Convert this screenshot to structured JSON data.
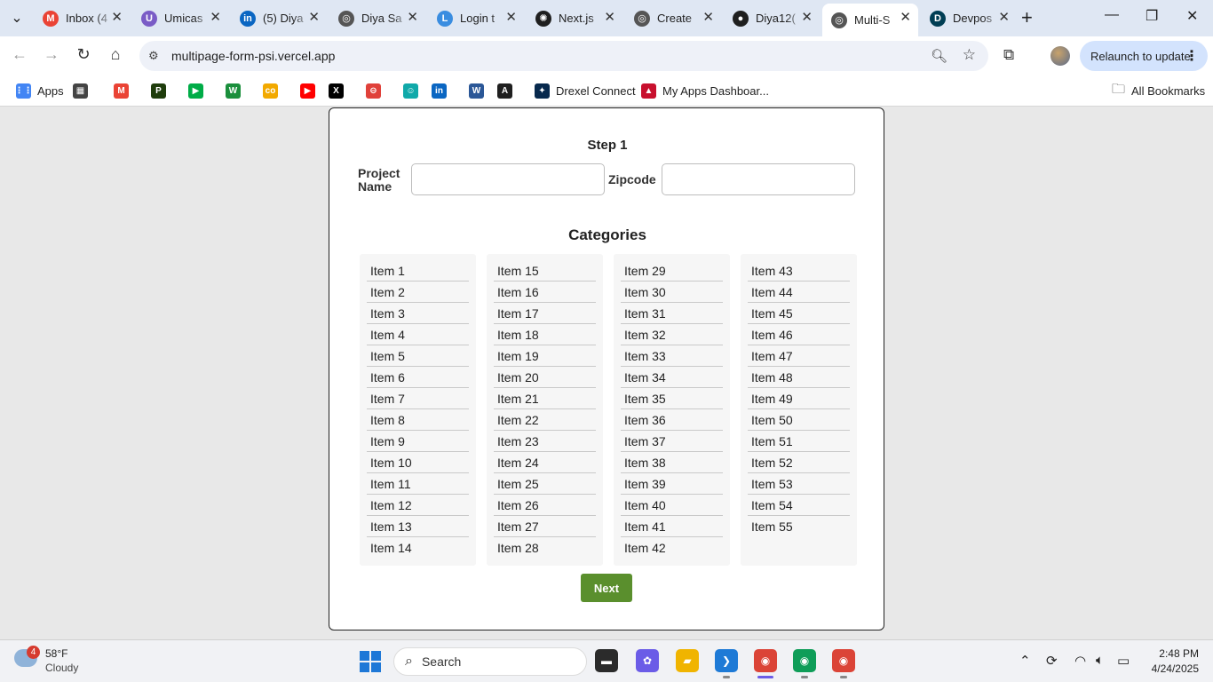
{
  "browser": {
    "tabs": [
      {
        "title": "Inbox (4",
        "favicon": "gmail-icon",
        "color": "#ea4335",
        "glyph": "M"
      },
      {
        "title": "Umicas",
        "favicon": "umicas-icon",
        "color": "#7a5cc6",
        "glyph": "U"
      },
      {
        "title": "(5) Diya",
        "favicon": "linkedin-icon",
        "color": "#0a66c2",
        "glyph": "in"
      },
      {
        "title": "Diya Sa",
        "favicon": "globe-icon",
        "color": "#555555",
        "glyph": "◎"
      },
      {
        "title": "Login t",
        "favicon": "login-icon",
        "color": "#3a8de0",
        "glyph": "L"
      },
      {
        "title": "Next.js",
        "favicon": "chatgpt-icon",
        "color": "#1f1f1f",
        "glyph": "✺"
      },
      {
        "title": "Create",
        "favicon": "globe-icon",
        "color": "#555555",
        "glyph": "◎"
      },
      {
        "title": "Diya12(",
        "favicon": "github-icon",
        "color": "#1f1f1f",
        "glyph": "●"
      },
      {
        "title": "Multi-S",
        "favicon": "globe-icon",
        "color": "#555555",
        "glyph": "◎",
        "active": true
      },
      {
        "title": "Devpos",
        "favicon": "devpost-icon",
        "color": "#003e54",
        "glyph": "D"
      }
    ],
    "url": "multipage-form-psi.vercel.app",
    "relaunch_label": "Relaunch to update",
    "bookmarks": [
      {
        "label": "Apps",
        "name": "apps-icon",
        "color": "#4285f4",
        "glyph": "⋮⋮"
      },
      {
        "label": "",
        "name": "grid-icon",
        "color": "#444444",
        "glyph": "▦"
      },
      {
        "label": "",
        "name": "gmail-icon",
        "color": "#ea4335",
        "glyph": "M"
      },
      {
        "label": "",
        "name": "paypal-icon",
        "color": "#1f3d0c",
        "glyph": "P"
      },
      {
        "label": "",
        "name": "meet-icon",
        "color": "#00ac47",
        "glyph": "▶"
      },
      {
        "label": "",
        "name": "wellfound-icon",
        "color": "#1a8f3c",
        "glyph": "W"
      },
      {
        "label": "",
        "name": "coursera-icon",
        "color": "#f2a900",
        "glyph": "co"
      },
      {
        "label": "",
        "name": "youtube-icon",
        "color": "#ff0000",
        "glyph": "▶"
      },
      {
        "label": "",
        "name": "x-icon",
        "color": "#000000",
        "glyph": "X"
      },
      {
        "label": "",
        "name": "circle-icon",
        "color": "#e0413a",
        "glyph": "⊖"
      },
      {
        "label": "",
        "name": "teal-app-icon",
        "color": "#10a9a9",
        "glyph": "☺"
      },
      {
        "label": "",
        "name": "linkedin-icon",
        "color": "#0a66c2",
        "glyph": "in"
      },
      {
        "label": "",
        "name": "word-icon",
        "color": "#2b5797",
        "glyph": "W"
      },
      {
        "label": "",
        "name": "app-icon",
        "color": "#1f1f1f",
        "glyph": "A"
      },
      {
        "label": "Drexel Connect",
        "name": "drexel-icon",
        "color": "#07294d",
        "glyph": "✦"
      },
      {
        "label": "My Apps Dashboar...",
        "name": "myapps-icon",
        "color": "#c8102e",
        "glyph": "▲"
      }
    ],
    "all_bookmarks_label": "All Bookmarks"
  },
  "form": {
    "step_title": "Step 1",
    "project_name_label": "Project Name",
    "project_name_value": "",
    "zipcode_label": "Zipcode",
    "zipcode_value": "",
    "categories_title": "Categories",
    "category_columns": [
      [
        "Item 1",
        "Item 2",
        "Item 3",
        "Item 4",
        "Item 5",
        "Item 6",
        "Item 7",
        "Item 8",
        "Item 9",
        "Item 10",
        "Item 11",
        "Item 12",
        "Item 13",
        "Item 14"
      ],
      [
        "Item 15",
        "Item 16",
        "Item 17",
        "Item 18",
        "Item 19",
        "Item 20",
        "Item 21",
        "Item 22",
        "Item 23",
        "Item 24",
        "Item 25",
        "Item 26",
        "Item 27",
        "Item 28"
      ],
      [
        "Item 29",
        "Item 30",
        "Item 31",
        "Item 32",
        "Item 33",
        "Item 34",
        "Item 35",
        "Item 36",
        "Item 37",
        "Item 38",
        "Item 39",
        "Item 40",
        "Item 41",
        "Item 42"
      ],
      [
        "Item 43",
        "Item 44",
        "Item 45",
        "Item 46",
        "Item 47",
        "Item 48",
        "Item 49",
        "Item 50",
        "Item 51",
        "Item 52",
        "Item 53",
        "Item 54",
        "Item 55"
      ]
    ],
    "next_label": "Next",
    "accent_color": "#5a8f2d"
  },
  "taskbar": {
    "weather_badge": "4",
    "weather_temp": "58°F",
    "weather_condition": "Cloudy",
    "search_label": "Search",
    "time": "2:48 PM",
    "date": "4/24/2025",
    "apps": [
      {
        "name": "terminal-app-icon",
        "color": "#2b2b2b",
        "glyph": "▬"
      },
      {
        "name": "copilot-app-icon",
        "color": "#6b5ce7",
        "glyph": "✿"
      },
      {
        "name": "file-explorer-icon",
        "color": "#f0b400",
        "glyph": "▰"
      },
      {
        "name": "vscode-icon",
        "color": "#1e7ad6",
        "glyph": "❯"
      },
      {
        "name": "chrome-icon",
        "color": "#db4437",
        "glyph": "◉",
        "active": true
      },
      {
        "name": "chrome-profile-d-icon",
        "color": "#0f9d58",
        "glyph": "◉"
      },
      {
        "name": "chrome-profile-c-icon",
        "color": "#db4437",
        "glyph": "◉"
      }
    ]
  }
}
